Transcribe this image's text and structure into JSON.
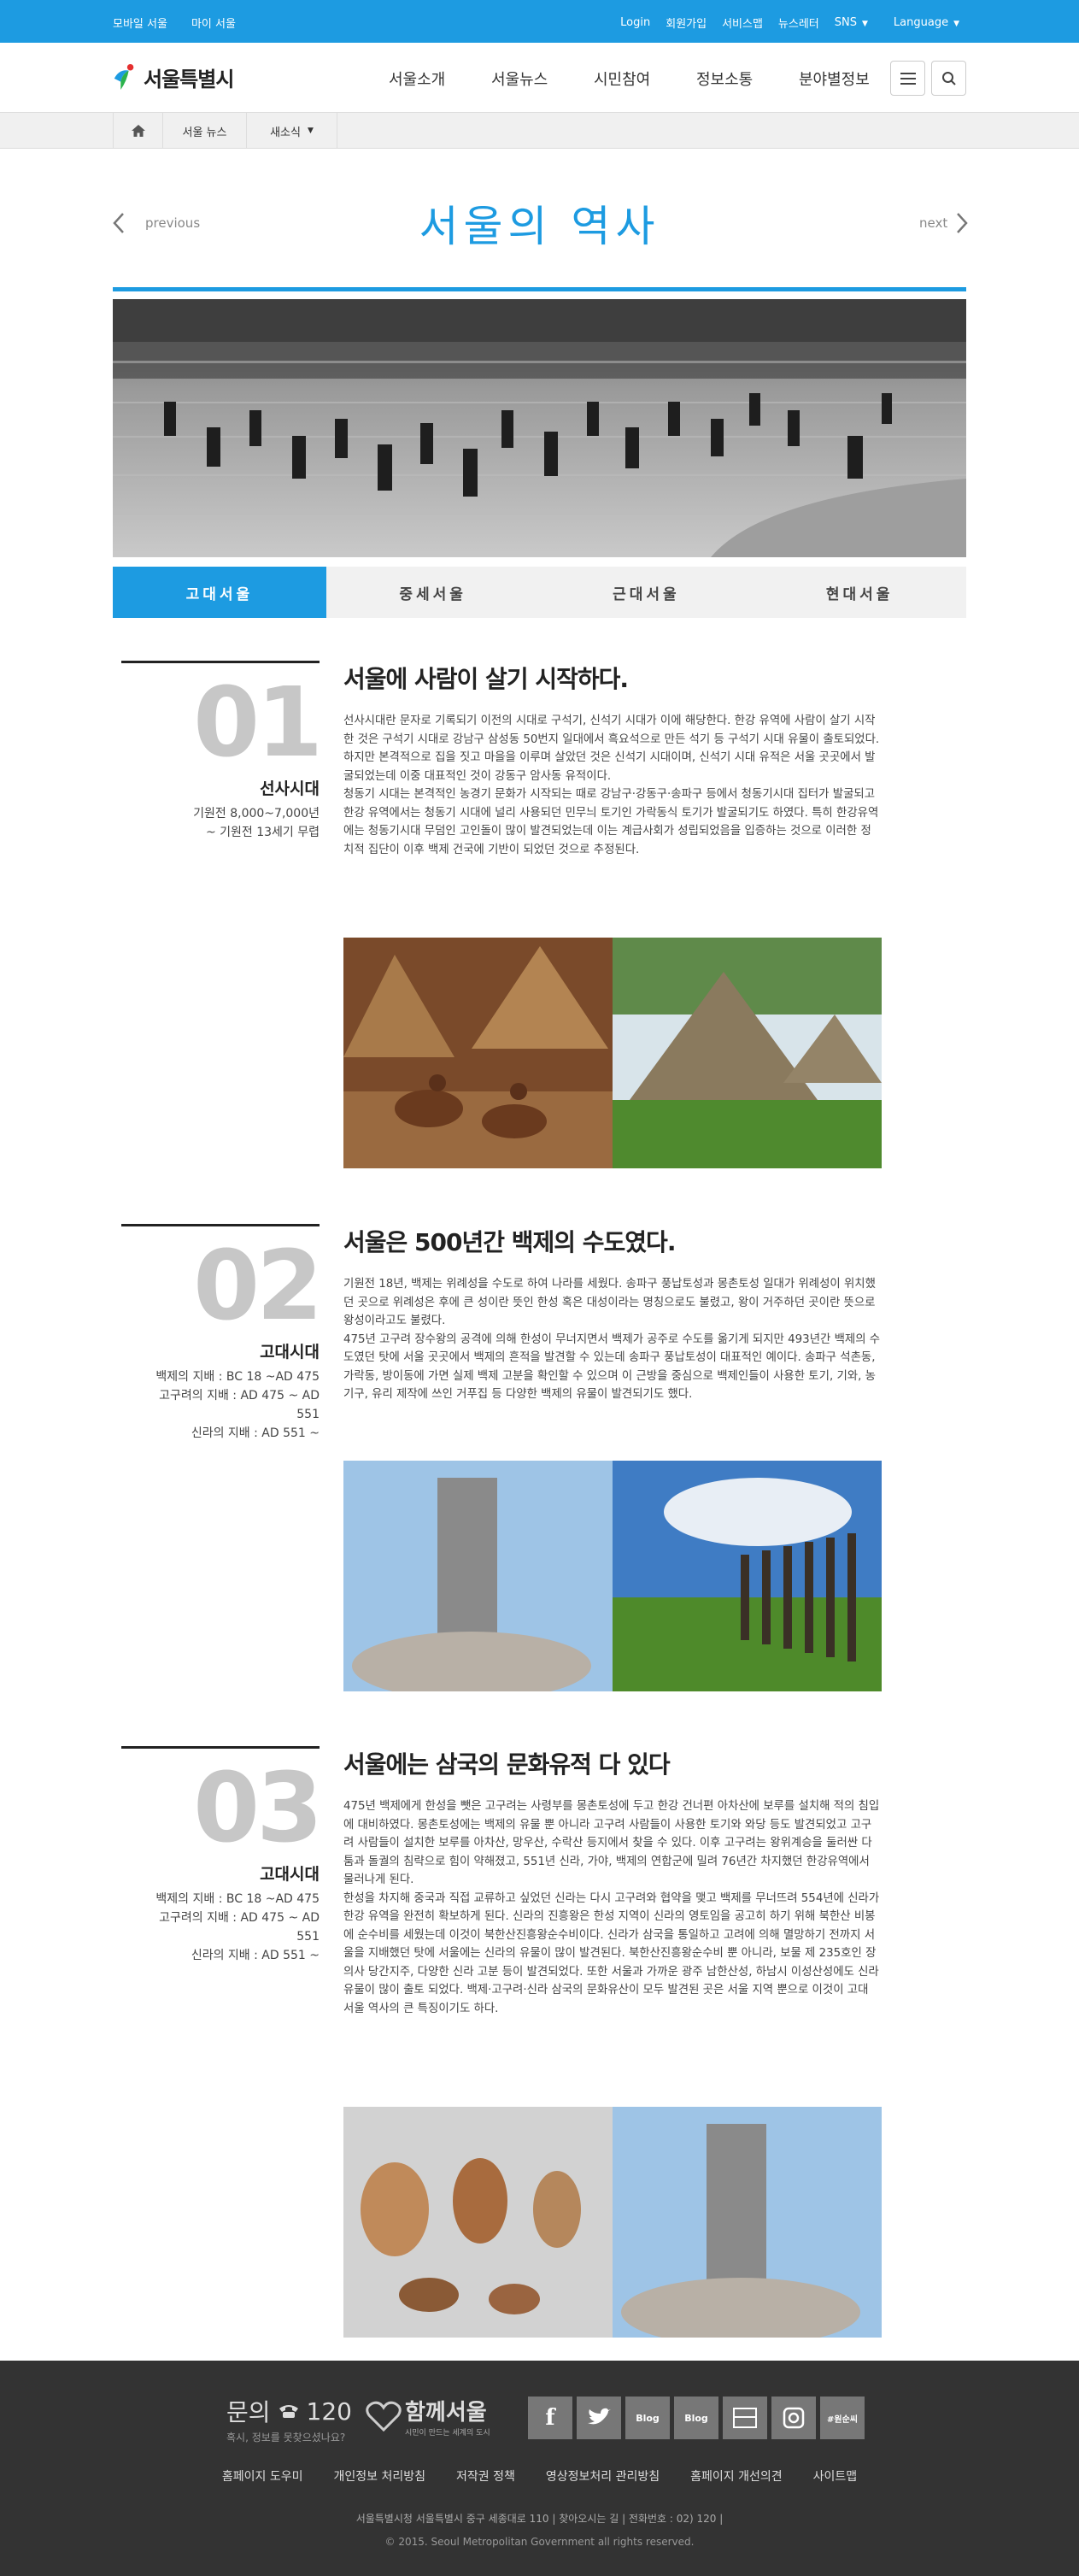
{
  "topbar": {
    "left_links": [
      "모바일 서울",
      "마이 서울"
    ],
    "right_links": [
      "Login",
      "회원가입",
      "서비스맵",
      "뉴스레터"
    ],
    "sns_label": "SNS",
    "language_label": "Language"
  },
  "header": {
    "logo_text": "서울특별시",
    "nav": [
      "서울소개",
      "서울뉴스",
      "시민참여",
      "정보소통",
      "분야별정보"
    ]
  },
  "breadcrumb": {
    "items": [
      "서울 뉴스",
      "새소식"
    ]
  },
  "page": {
    "title": "서울의 역사",
    "prev_label": "previous",
    "next_label": "next"
  },
  "tabs": [
    "고대서울",
    "중세서울",
    "근대서울",
    "현대서울"
  ],
  "sections": [
    {
      "number": "01",
      "era": "선사시대",
      "period": "기원전 8,000~7,000년\n~ 기원전 13세기 무렵",
      "heading": "서울에 사람이 살기 시작하다.",
      "paragraphs": [
        "선사시대란 문자로 기록되기 이전의 시대로 구석기, 신석기 시대가 이에 해당한다. 한강 유역에 사람이 살기 시작한 것은 구석기 시대로 강남구 삼성동 50번지 일대에서 흑요석으로 만든 석기 등 구석기 시대 유물이 출토되었다. 하지만 본격적으로 집을 짓고 마을을 이루며 살았던 것은 신석기 시대이며, 신석기 시대 유적은 서울 곳곳에서 발굴되었는데 이중 대표적인 것이 강동구 암사동 유적이다.",
        "청동기 시대는 본격적인 농경기 문화가 시작되는 때로 강남구·강동구·송파구 등에서 청동기시대 집터가 발굴되고 한강 유역에서는 청동기 시대에 널리 사용되던 민무늬 토기인 가락동식 토기가 발굴되기도 하였다. 특히 한강유역에는 청동기시대 무덤인 고인돌이 많이 발견되었는데 이는 계급사회가 성립되었음을 입증하는 것으로 이러한 정치적 집단이 이후 백제 건국에 기반이 되었던 것으로 추정된다."
      ]
    },
    {
      "number": "02",
      "era": "고대시대",
      "period": "백제의 지배 : BC 18 ~AD 475\n고구려의 지배 : AD 475 ~ AD\n551\n신라의 지배 : AD 551 ~",
      "heading": "서울은 500년간 백제의 수도였다.",
      "paragraphs": [
        "기원전 18년, 백제는 위례성을 수도로 하여 나라를 세웠다. 송파구 풍납토성과 몽촌토성 일대가 위례성이 위치했던 곳으로 위례성은 후에 큰 성이란 뜻인 한성 혹은 대성이라는 명칭으로도 불렸고, 왕이 거주하던 곳이란 뜻으로 왕성이라고도 불렸다.",
        "475년 고구려 장수왕의 공격에 의해 한성이 무너지면서 백제가 공주로 수도를 옮기게 되지만 493년간 백제의 수도였던 탓에 서울 곳곳에서 백제의 흔적을 발견할 수 있는데 송파구 풍납토성이 대표적인 예이다. 송파구 석촌동, 가락동, 방이동에 가면 실제 백제 고분을 확인할 수 있으며 이 근방을 중심으로 백제인들이 사용한 토기, 기와, 농기구, 유리 제작에 쓰인 거푸집 등 다양한 백제의 유물이 발견되기도 했다."
      ]
    },
    {
      "number": "03",
      "era": "고대시대",
      "period": "백제의 지배 : BC 18 ~AD 475\n고구려의 지배 : AD 475 ~ AD\n551\n신라의 지배 : AD 551 ~",
      "heading": "서울에는 삼국의 문화유적 다 있다",
      "paragraphs": [
        "475년 백제에게 한성을 뺏은 고구려는 사령부를 몽촌토성에 두고 한강 건너편 아차산에 보루를 설치해 적의 침입에 대비하였다. 몽촌토성에는 백제의 유물 뿐 아니라 고구려 사람들이 사용한 토기와 와당 등도 발견되었고 고구려 사람들이 설치한 보루를 아차산, 망우산, 수락산 등지에서 찾을 수 있다. 이후 고구려는 왕위계승을 둘러싼 다툼과 돌궐의 침략으로 힘이 약해졌고, 551년 신라, 가야, 백제의 연합군에 밀려 76년간 차지했던 한강유역에서 물러나게 된다.",
        "한성을 차지해 중국과 직접 교류하고 싶었던 신라는 다시 고구려와 협약을 맺고 백제를 무너뜨려 554년에 신라가 한강 유역을 완전히 확보하게 된다. 신라의 진흥왕은 한성 지역이 신라의 영토임을 공고히 하기 위해 북한산 비봉에 순수비를 세웠는데 이것이 북한산진흥왕순수비이다. 신라가 삼국을 통일하고 고려에 의해 멸망하기 전까지 서울을 지배했던 탓에 서울에는 신라의 유물이 많이 발견된다. 북한산진흥왕순수비 뿐 아니라, 보물 제 235호인 장의사 당간지주, 다양한 신라 고분 등이 발견되었다. 또한 서울과 가까운 광주 남한산성, 하남시 이성산성에도 신라 유물이 많이 출토 되었다. 백제·고구려·신라 삼국의 문화유산이 모두 발견된 곳은 서울 지역 뿐으로 이것이 고대 서울 역사의 큰 특징이기도 하다."
      ]
    }
  ],
  "footer": {
    "contact_label": "문의",
    "contact_number": "120",
    "contact_sub": "혹시, 정보를 못찾으셨나요?",
    "slogan": "함께서울",
    "slogan_sub": "시민이 만드는 세계의 도시",
    "sns": [
      "f",
      "t",
      "Blog",
      "Blog",
      "",
      "",
      "#원순씨"
    ],
    "links": [
      "홈페이지 도우미",
      "개인정보 처리방침",
      "저작권 정책",
      "영상정보처리 관리방침",
      "홈페이지 개선의견",
      "사이트맵"
    ],
    "address": "서울특별시청 서울특별시 중구 세종대로 110  |  찾아오시는 길  |  전화번호 : 02) 120  |",
    "copyright": "© 2015. Seoul Metropolitan Government all rights reserved."
  },
  "colors": {
    "accent": "#1d9be1",
    "footer_bg": "#333333",
    "number_gray": "#c7c7c7"
  }
}
